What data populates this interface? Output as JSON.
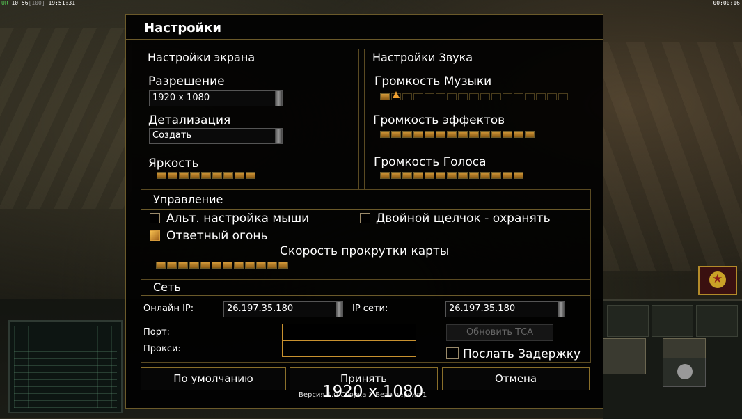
{
  "hud": {
    "top_left_ur": "UR",
    "top_left_stats": "10 56",
    "top_left_bracket": "[100]",
    "top_left_clock": "19:51:31",
    "top_right_timer": "00:00:16"
  },
  "dialog": {
    "title": "Настройки",
    "screen": {
      "title": "Настройки экрана",
      "resolution_label": "Разрешение",
      "resolution_value": "1920 x 1080",
      "detail_label": "Детализация",
      "detail_value": "Создать",
      "brightness_label": "Яркость",
      "brightness_level": 1.0
    },
    "sound": {
      "title": "Настройки Звука",
      "music_label": "Громкость Музыки",
      "music_level": 0.05,
      "effects_label": "Громкость эффектов",
      "effects_level": 1.0,
      "voice_label": "Громкость Голоса",
      "voice_level": 1.0
    },
    "controls": {
      "title": "Управление",
      "alt_mouse_label": "Альт. настройка мыши",
      "alt_mouse_checked": false,
      "double_click_label": "Двойной щелчок - охранять",
      "double_click_checked": false,
      "return_fire_label": "Ответный огонь",
      "return_fire_checked": true,
      "scroll_speed_label": "Скорость прокрутки карты",
      "scroll_speed_level": 1.0
    },
    "network": {
      "title": "Сеть",
      "online_ip_label": "Онлайн IP:",
      "online_ip_value": "26.197.35.180",
      "lan_ip_label": "IP сети:",
      "lan_ip_value": "26.197.35.180",
      "port_label": "Порт:",
      "port_value": "",
      "proxy_label": "Прокси:",
      "proxy_value": "",
      "refresh_label": "Обновить ТСА",
      "send_delay_label": "Послать Задержку",
      "send_delay_checked": false
    },
    "buttons": {
      "defaults": "По умолчанию",
      "accept": "Принять",
      "cancel": "Отмена"
    },
    "footer": "Версия 1.0 Сборка 1 Бета версия 1",
    "overlay_resolution": "1920 x 1080"
  },
  "colors": {
    "panel_border": "#6b5a2a",
    "accent_orange": "#d49a3a",
    "text": "#ffffff"
  }
}
